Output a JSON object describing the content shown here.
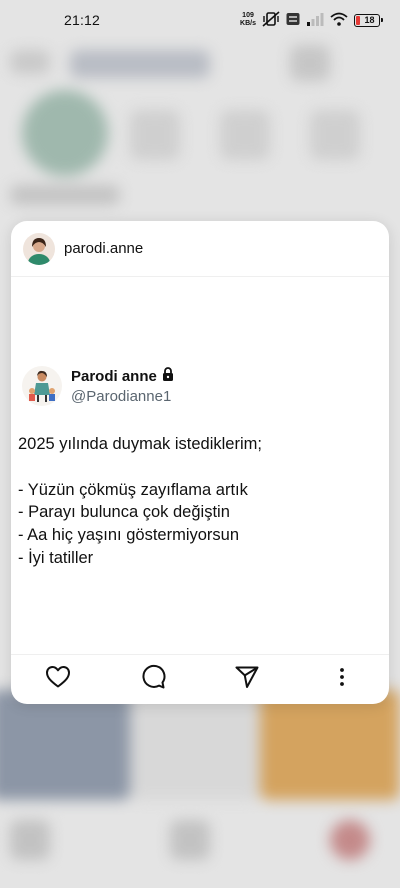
{
  "status_bar": {
    "time": "21:12",
    "net_speed_value": "109",
    "net_speed_unit": "KB/s",
    "battery_level": "18",
    "colors": {
      "battery_low": "#e53935"
    }
  },
  "preview": {
    "username": "parodi.anne",
    "avatar_icon": "profile-avatar",
    "tweet": {
      "display_name": "Parodi anne",
      "handle": "@Parodianne1",
      "lock_icon": "lock-icon",
      "lines": [
        "2025 yılında duymak istediklerim;",
        "",
        "- Yüzün çökmüş zayıflama artık",
        "- Parayı bulunca çok değiştin",
        "- Aa hiç yaşını göstermiyorsun",
        "- İyi tatiller"
      ]
    },
    "actions": [
      "heart-icon",
      "comment-icon",
      "share-icon",
      "more-icon"
    ]
  }
}
